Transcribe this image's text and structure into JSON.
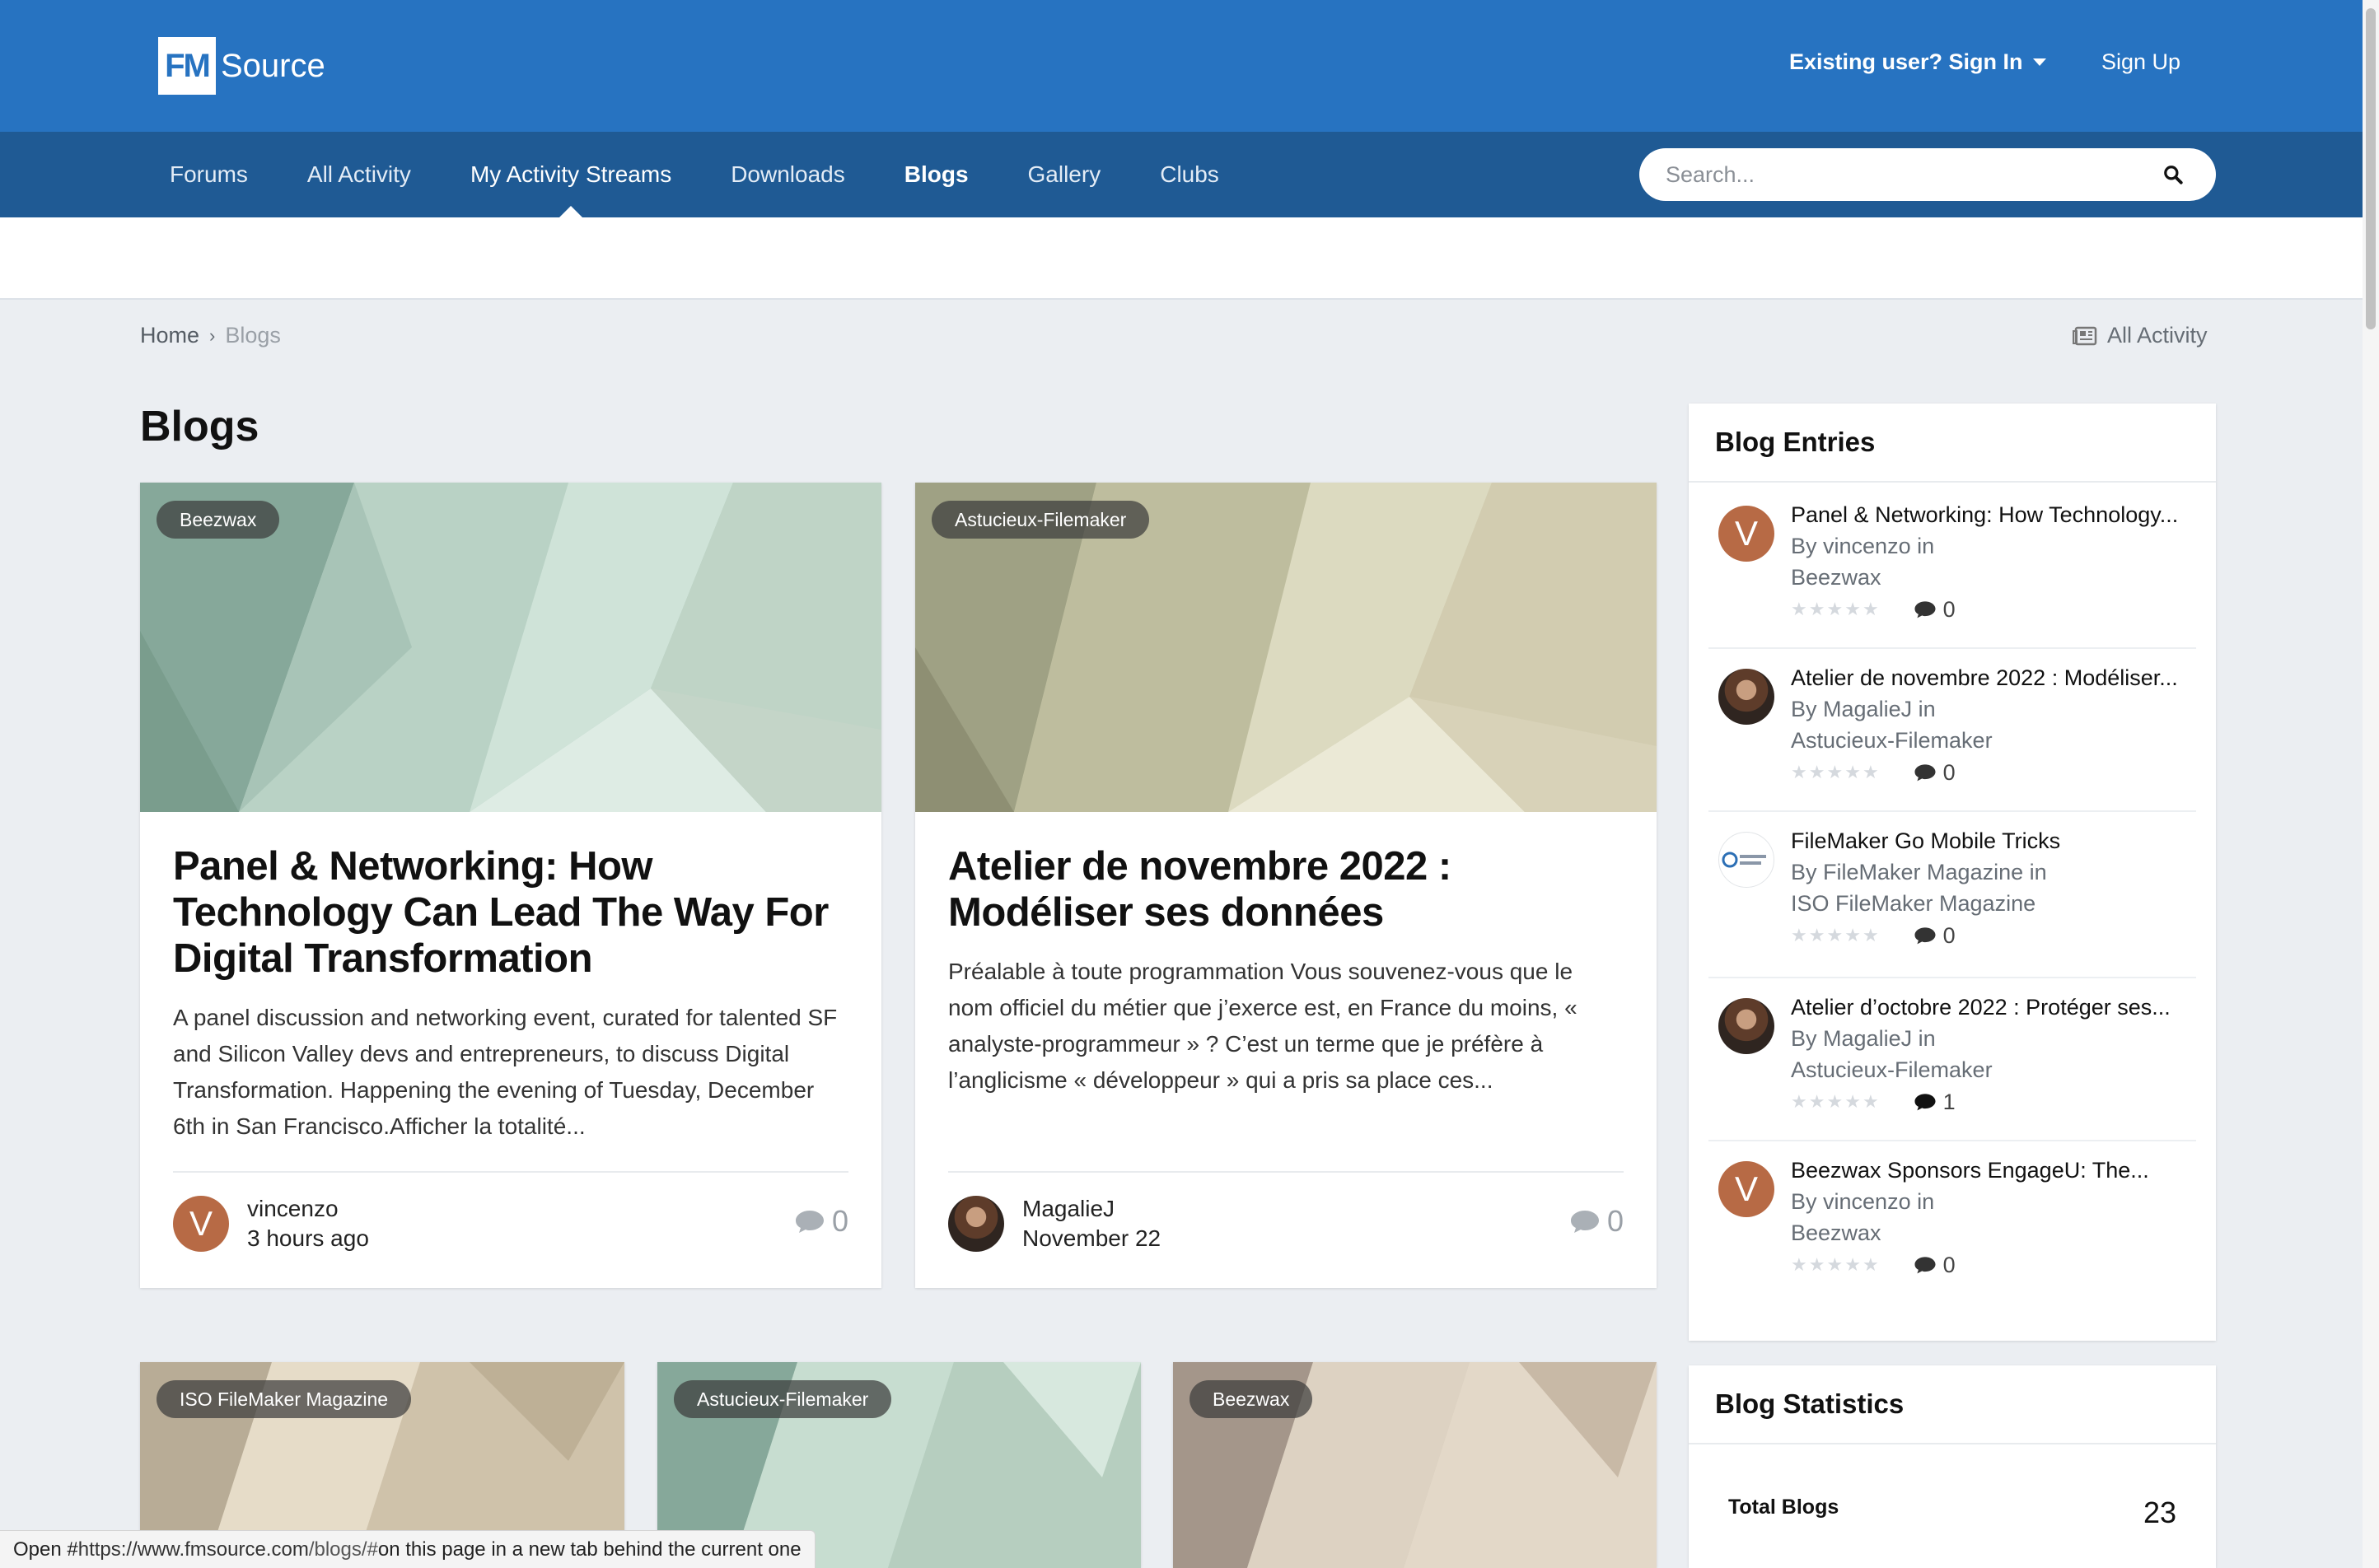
{
  "header": {
    "logo_box": "FM",
    "logo_text": "Source",
    "signin_label": "Existing user? Sign In",
    "signup_label": "Sign Up"
  },
  "nav": {
    "items": [
      "Forums",
      "All Activity",
      "My Activity Streams",
      "Downloads",
      "Blogs",
      "Gallery",
      "Clubs"
    ],
    "active": "My Activity Streams",
    "current": "Blogs"
  },
  "search": {
    "placeholder": "Search..."
  },
  "breadcrumb": {
    "home": "Home",
    "current": "Blogs"
  },
  "all_activity_label": "All Activity",
  "page_title": "Blogs",
  "featured": [
    {
      "tag": "Beezwax",
      "title": "Panel & Networking: How Technology Can Lead The Way For Digital Transformation",
      "excerpt": "A panel discussion and networking event, curated for talented SF and Silicon Valley devs and entrepreneurs, to discuss Digital Transformation. Happening the evening of Tuesday, December 6th in San Francisco.Afficher la totalité...",
      "author": "vincenzo",
      "avatar_letter": "V",
      "date": "3 hours ago",
      "comments": "0"
    },
    {
      "tag": "Astucieux-Filemaker",
      "title": "Atelier de novembre 2022 : Modéliser ses données",
      "excerpt": "Préalable à toute programmation Vous souvenez-vous que le nom officiel du métier que j’exerce est, en France du moins, « analyste-programmeur » ? C’est un terme que je préfère à l’anglicisme « développeur » qui a pris sa place ces...",
      "author": "MagalieJ",
      "date": "November 22",
      "comments": "0"
    }
  ],
  "more_cards": [
    {
      "tag": "ISO FileMaker Magazine"
    },
    {
      "tag": "Astucieux-Filemaker"
    },
    {
      "tag": "Beezwax"
    }
  ],
  "blog_entries": {
    "title": "Blog Entries",
    "by_prefix": "By",
    "in_suffix": "in",
    "items": [
      {
        "title": "Panel & Networking: How Technology...",
        "author": "vincenzo",
        "blog": "Beezwax",
        "comments": "0",
        "avatar_letter": "V"
      },
      {
        "title": "Atelier de novembre 2022 : Modéliser...",
        "author": "MagalieJ",
        "blog": "Astucieux-Filemaker",
        "comments": "0"
      },
      {
        "title": "FileMaker Go Mobile Tricks",
        "author": "FileMaker Magazine",
        "blog": "ISO FileMaker Magazine",
        "comments": "0"
      },
      {
        "title": "Atelier d’octobre 2022 : Protéger ses...",
        "author": "MagalieJ",
        "blog": "Astucieux-Filemaker",
        "comments": "1"
      },
      {
        "title": "Beezwax Sponsors EngageU: The...",
        "author": "vincenzo",
        "blog": "Beezwax",
        "comments": "0",
        "avatar_letter": "V"
      }
    ]
  },
  "blog_statistics": {
    "title": "Blog Statistics",
    "total_blogs_label": "Total Blogs",
    "total_blogs_value": "23"
  },
  "status_bar": {
    "prefix": "Open #",
    "url_domain": "https://www.fmsource.com",
    "url_path": "/blogs/#",
    "suffix": " on this page in a new tab behind the current one"
  },
  "colors": {
    "header": "#2773c1",
    "nav": "#1f5a94",
    "background": "#ebeef2",
    "avatar_v": "#b76a45"
  }
}
